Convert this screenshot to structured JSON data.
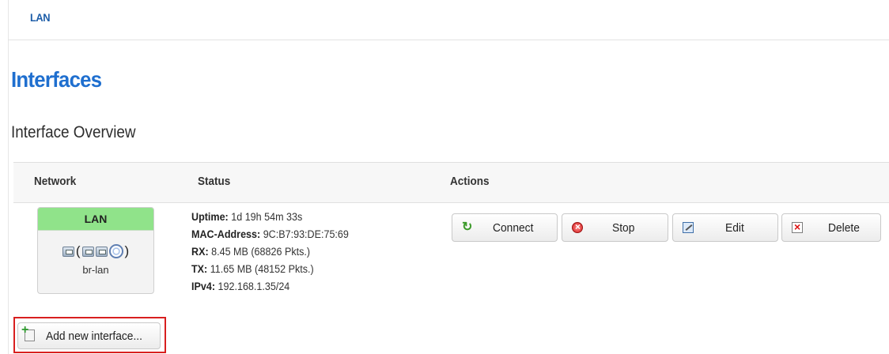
{
  "tabs": [
    {
      "label": "LAN"
    }
  ],
  "page": {
    "title": "Interfaces",
    "section_title": "Interface Overview"
  },
  "table": {
    "headers": {
      "network": "Network",
      "status": "Status",
      "actions": "Actions"
    },
    "rows": [
      {
        "network": {
          "name": "LAN",
          "device": "br-lan",
          "icons": [
            "ethernet-port-icon",
            "ethernet-port-icon",
            "ethernet-port-icon",
            "wifi-icon"
          ],
          "bracket_open": "(",
          "bracket_close": ")",
          "header_color": "#90e38a"
        },
        "status": [
          {
            "label": "Uptime:",
            "value": "1d 19h 54m 33s"
          },
          {
            "label": "MAC-Address:",
            "value": "9C:B7:93:DE:75:69"
          },
          {
            "label": "RX:",
            "value": "8.45 MB (68826 Pkts.)"
          },
          {
            "label": "TX:",
            "value": "11.65 MB (48152 Pkts.)"
          },
          {
            "label": "IPv4:",
            "value": "192.168.1.35/24"
          }
        ],
        "actions": [
          {
            "label": "Connect",
            "icon": "refresh-icon"
          },
          {
            "label": "Stop",
            "icon": "stop-icon"
          },
          {
            "label": "Edit",
            "icon": "edit-icon"
          },
          {
            "label": "Delete",
            "icon": "delete-icon"
          }
        ]
      }
    ]
  },
  "add_button": {
    "label": "Add new interface...",
    "icon": "add-icon",
    "highlight_color": "#d81f1f"
  },
  "colors": {
    "accent": "#1f6fcf",
    "link": "#1d5da8"
  }
}
